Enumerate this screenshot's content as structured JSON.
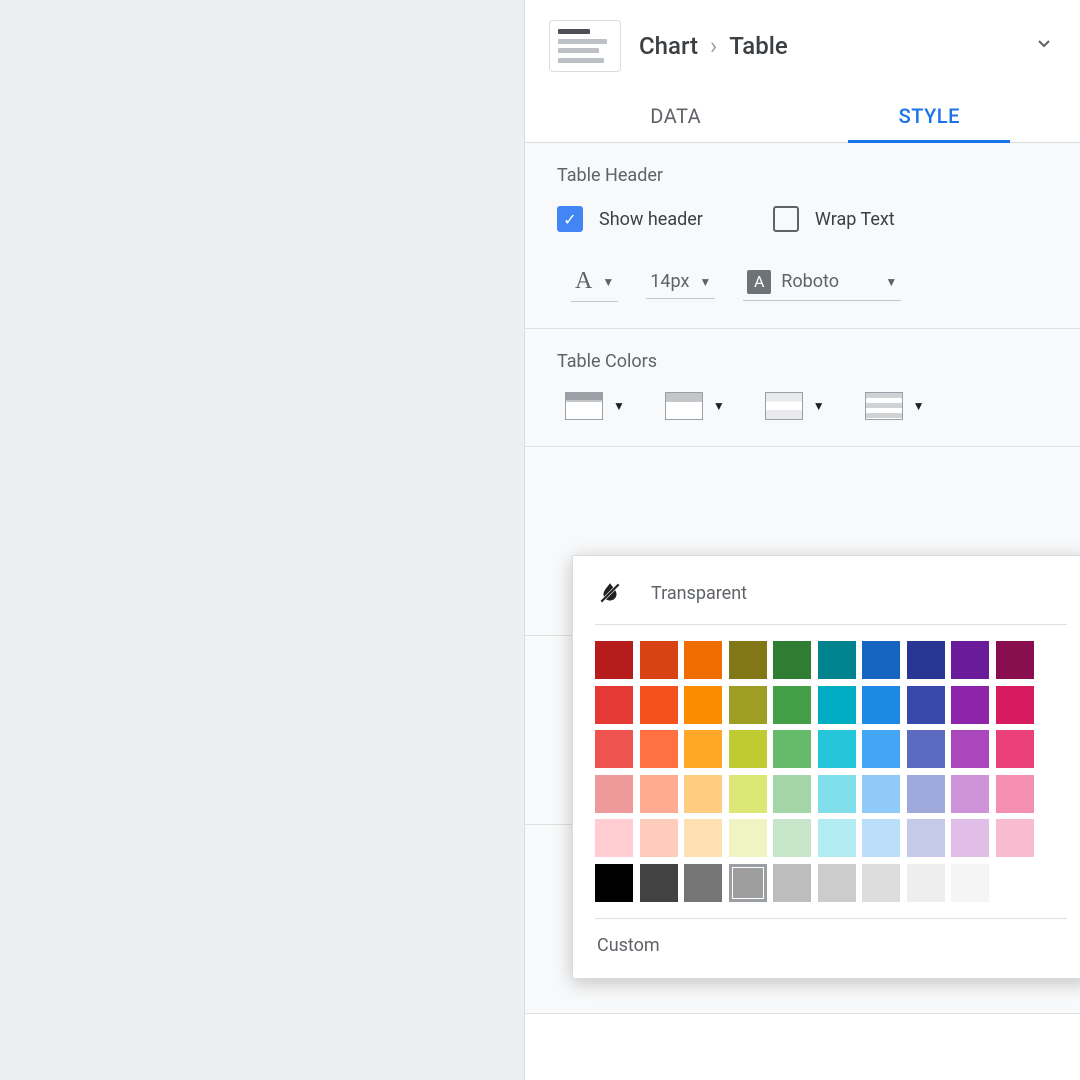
{
  "header": {
    "root": "Chart",
    "current": "Table"
  },
  "tabs": {
    "data": "DATA",
    "style": "STYLE"
  },
  "tableHeader": {
    "title": "Table Header",
    "showHeader": "Show header",
    "wrapText": "Wrap Text",
    "fontSize": "14px",
    "fontFamily": "Roboto"
  },
  "tableColors": {
    "title": "Table Colors"
  },
  "picker": {
    "transparent": "Transparent",
    "custom": "Custom",
    "selectedIndex": 53,
    "colors": [
      "#b71c1c",
      "#d84315",
      "#ef6c00",
      "#827717",
      "#2e7d32",
      "#00838f",
      "#1565c0",
      "#283593",
      "#6a1b9a",
      "#880e4f",
      "#e53935",
      "#f4511e",
      "#fb8c00",
      "#9e9d24",
      "#43a047",
      "#00acc1",
      "#1e88e5",
      "#3949ab",
      "#8e24aa",
      "#d81b60",
      "#ef5350",
      "#ff7043",
      "#ffa726",
      "#c0ca33",
      "#66bb6a",
      "#26c6da",
      "#42a5f5",
      "#5c6bc0",
      "#ab47bc",
      "#ec407a",
      "#ef9a9a",
      "#ffab91",
      "#ffcc80",
      "#dce775",
      "#a5d6a7",
      "#80deea",
      "#90caf9",
      "#9fa8da",
      "#ce93d8",
      "#f48fb1",
      "#ffcdd2",
      "#ffccbc",
      "#ffe0b2",
      "#f0f4c3",
      "#c8e6c9",
      "#b2ebf2",
      "#bbdefb",
      "#c5cae9",
      "#e1bee7",
      "#f8bbd0",
      "#000000",
      "#424242",
      "#757575",
      "#9e9e9e",
      "#bdbdbd",
      "#cccccc",
      "#dddddd",
      "#eeeeee",
      "#f5f5f5",
      "#ffffff"
    ]
  }
}
